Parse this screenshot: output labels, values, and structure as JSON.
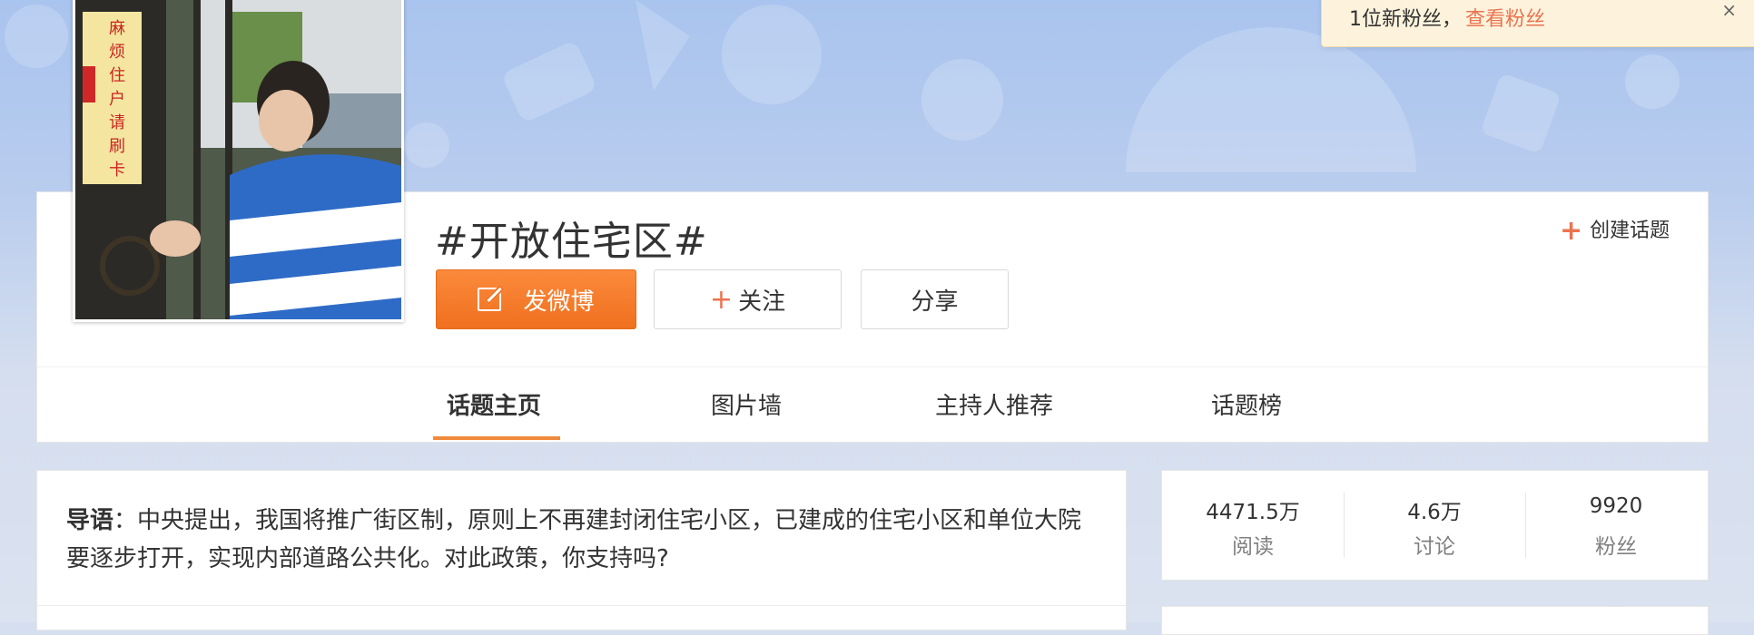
{
  "toast": {
    "text": "1位新粉丝，",
    "link": "查看粉丝",
    "close": "×"
  },
  "header": {
    "title": "#开放住宅区#",
    "create_topic": "创建话题",
    "create_plus": "+",
    "buttons": {
      "post": "发微博",
      "follow_plus": "+",
      "follow": "关注",
      "share": "分享"
    }
  },
  "cover": {
    "sign_text": [
      "麻",
      "烦",
      "住",
      "户",
      "请",
      "刷",
      "卡"
    ]
  },
  "tabs": [
    {
      "label": "话题主页",
      "active": true
    },
    {
      "label": "图片墙",
      "active": false
    },
    {
      "label": "主持人推荐",
      "active": false
    },
    {
      "label": "话题榜",
      "active": false
    }
  ],
  "lead": {
    "label": "导语",
    "text": "：中央提出，我国将推广街区制，原则上不再建封闭住宅小区，已建成的住宅小区和单位大院要逐步打开，实现内部道路公共化。对此政策，你支持吗?"
  },
  "stats": [
    {
      "value": "4471.5万",
      "label": "阅读"
    },
    {
      "value": "4.6万",
      "label": "讨论"
    },
    {
      "value": "9920",
      "label": "粉丝"
    }
  ],
  "colors": {
    "accent": "#eb7350",
    "post_button": "#f07320",
    "banner": "#b8ccee"
  }
}
